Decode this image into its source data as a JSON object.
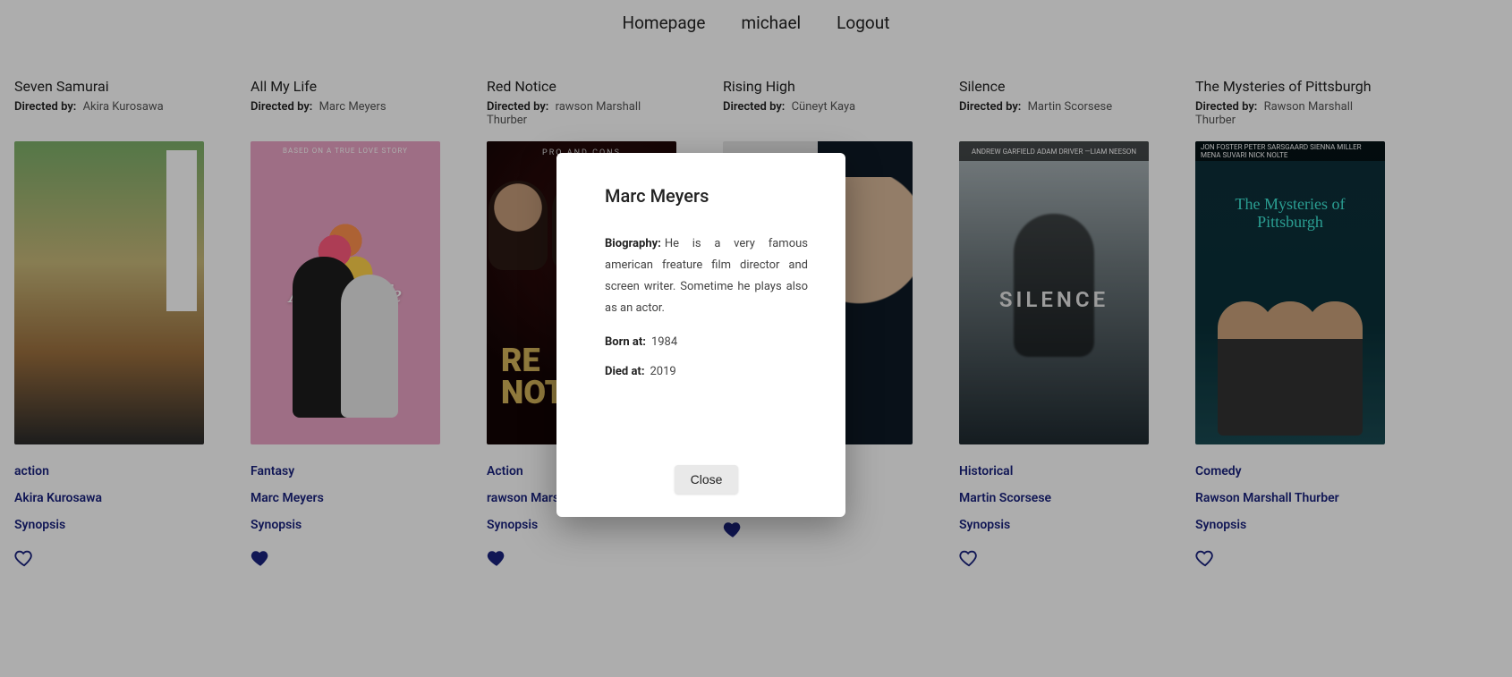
{
  "nav": {
    "homepage": "Homepage",
    "user": "michael",
    "logout": "Logout"
  },
  "labels": {
    "directed_by": "Directed by:",
    "synopsis": "Synopsis"
  },
  "movies": [
    {
      "title": "Seven Samurai",
      "director": "Akira Kurosawa",
      "genre": "action",
      "director_link": "Akira Kurosawa",
      "favorited": false
    },
    {
      "title": "All My Life",
      "director": "Marc Meyers",
      "genre": "Fantasy",
      "director_link": "Marc Meyers",
      "favorited": true
    },
    {
      "title": "Red Notice",
      "director": "rawson Marshall Thurber",
      "genre": "Action",
      "director_link": "rawson Marshall Thurber",
      "favorited": true
    },
    {
      "title": "Rising High",
      "director": "Cüneyt Kaya",
      "genre": "",
      "director_link": "",
      "favorited": true
    },
    {
      "title": "Silence",
      "director": "Martin Scorsese",
      "genre": "Historical",
      "director_link": "Martin Scorsese",
      "favorited": false
    },
    {
      "title": "The Mysteries of Pittsburgh",
      "director": "Rawson Marshall Thurber",
      "genre": "Comedy",
      "director_link": "Rawson Marshall Thurber",
      "favorited": false
    }
  ],
  "modal": {
    "name": "Marc Meyers",
    "bio_label": "Biography:",
    "bio_text": "He is a very famous american freature film director and screen writer. Sometime he plays also as an actor.",
    "born_label": "Born at:",
    "born_value": "1984",
    "died_label": "Died at:",
    "died_value": "2019",
    "close": "Close"
  },
  "poster_text": {
    "all_my_life_top": "BASED ON A TRUE LOVE STORY",
    "all_my_life_title": "All My Life",
    "red_notice_top": "PRO AND CONS",
    "red_notice_t1": "RE",
    "red_notice_t2": "NOT",
    "silence_cast": "ANDREW GARFIELD   ADAM DRIVER   —LIAM NEESON",
    "silence_title": "SILENCE",
    "pitts_cast": "JON FOSTER  PETER SARSGAARD  SIENNA MILLER  MENA SUVARI  NICK NOLTE",
    "pitts_title": "The Mysteries of Pittsburgh"
  }
}
